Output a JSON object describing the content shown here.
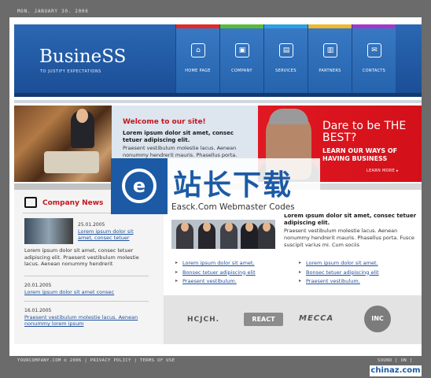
{
  "date": "MON. JANUARY 30. 2006",
  "header": {
    "logo": "BusineSS",
    "tagline": "TO JUSTIFY EXPECTATIONS"
  },
  "nav": [
    {
      "label": "HOME PAGE",
      "icon": "home-icon",
      "stripe": "#e22a2a",
      "glyph": "⌂"
    },
    {
      "label": "COMPANY",
      "icon": "company-icon",
      "stripe": "#5bbb36",
      "glyph": "▣"
    },
    {
      "label": "SERVICES",
      "icon": "services-icon",
      "stripe": "#2ea1df",
      "glyph": "▤"
    },
    {
      "label": "PARTNERS",
      "icon": "partners-icon",
      "stripe": "#f0b82a",
      "glyph": "▥"
    },
    {
      "label": "CONTACTS",
      "icon": "contacts-icon",
      "stripe": "#a338c7",
      "glyph": "✉"
    }
  ],
  "welcome": {
    "title": "Welcome to our site!",
    "bold": "Lorem ipsum dolor sit amet, consec tetuer adipiscing elit.",
    "text": "Praesent vestibulum molestie lacus. Aenean nonummy hendrerit mauris. Phasellus porta."
  },
  "promo": {
    "title": "Dare to be THE BEST?",
    "sub": "LEARN OUR WAYS OF HAVING BUSINESS",
    "more": "LEARN MORE ▸"
  },
  "company_news": {
    "title": "Company News",
    "items": [
      {
        "date": "25.01.2005",
        "link": "Lorem ipsum dolor sit amet, consec tetuer"
      },
      {
        "date": "20.01.2005",
        "link": "Lorem ipsum dolor sit amet consec"
      },
      {
        "date": "16.01.2005",
        "link": "Praesent vestibulum molestie lacus. Aenean nonummy lorem ipsum"
      }
    ],
    "text": "Lorem ipsum dolor sit amet, consec tetuer adipiscing elit. Praesent vestibulum molestie lacus. Aenean nonummy hendrerit"
  },
  "about": {
    "bold": "Lorem ipsum dolor sit amet, consec tetuer adipiscing elit.",
    "text": "Praesent vestibulum molestie lacus. Aenean nonummy hendrerit mauris. Phasellus porta. Fusce suscipit varius mi. Cum sociis"
  },
  "links_left": [
    "Lorem ipsum dolor sit amet.",
    "Bonsec tetuer adipiscing elit",
    "Praesent vestibulum."
  ],
  "links_right": [
    "Lorem ipsum dolor sit amet.",
    "Bonsec tetuer adipiscing elit",
    "Praesent vestibulum."
  ],
  "partners": [
    "HCJCH.",
    "REACT",
    "MECCA",
    "INC"
  ],
  "footer": {
    "left": "YOURCOMPANY.COM © 2006 | PRIVACY POLICY | TERMS OF USE",
    "right": "SOUND [ ON ]"
  },
  "watermark": {
    "logo": "e",
    "text": "站长下载",
    "sub": "Easck.Com Webmaster Codes",
    "site": "chinaz.com"
  },
  "colors": {
    "background": "#6b6b6b",
    "header": "#1f5aa5",
    "accent_red": "#d31019",
    "link": "#1e4f9e"
  }
}
